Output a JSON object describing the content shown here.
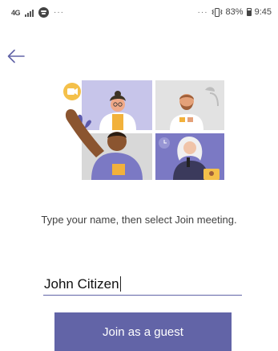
{
  "status_bar": {
    "network": "4G",
    "network_sub": "",
    "more": "···",
    "right_more": "···",
    "battery": "83%",
    "time": "9:45"
  },
  "instructions": "Type your name, then select Join meeting.",
  "name_input": {
    "value": "John Citizen"
  },
  "join_button": {
    "label": "Join as a guest"
  },
  "colors": {
    "accent": "#6264a7",
    "illustration_lavender": "#d8d7ee"
  }
}
